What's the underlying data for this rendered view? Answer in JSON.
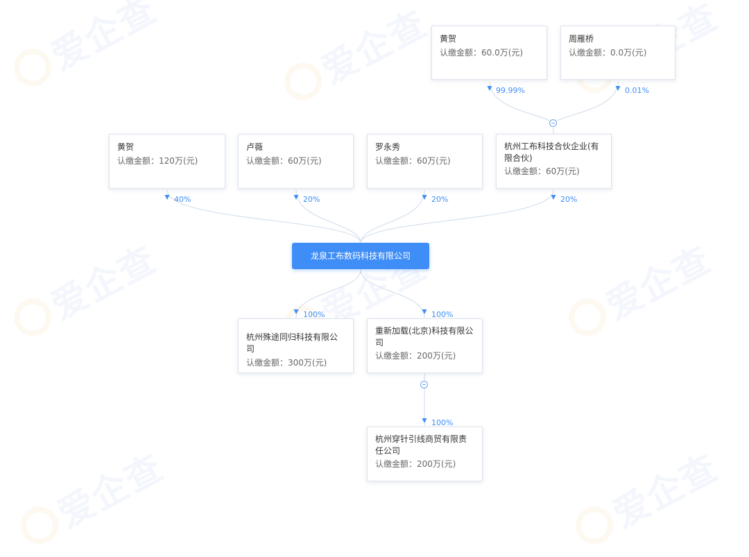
{
  "watermark": {
    "text": "爱企查"
  },
  "root": {
    "name": "龙泉工布数码科技有限公司"
  },
  "shareholders": [
    {
      "id": "s1",
      "name": "黄贺",
      "amount": "认缴金额：120万(元)",
      "percent": "40%"
    },
    {
      "id": "s2",
      "name": "卢薇",
      "amount": "认缴金额：60万(元)",
      "percent": "20%"
    },
    {
      "id": "s3",
      "name": "罗永秀",
      "amount": "认缴金额：60万(元)",
      "percent": "20%"
    },
    {
      "id": "s4",
      "name": "杭州工布科技合伙企业(有限合伙)",
      "amount": "认缴金额：60万(元)",
      "percent": "20%"
    }
  ],
  "upper_shareholders": [
    {
      "id": "u1",
      "name": "黄贺",
      "amount": "认缴金额：60.0万(元)",
      "percent": "99.99%"
    },
    {
      "id": "u2",
      "name": "周雁桥",
      "amount": "认缴金额：0.0万(元)",
      "percent": "0.01%"
    }
  ],
  "investments": [
    {
      "id": "i1",
      "name": "杭州殊途同归科技有限公司",
      "amount": "认缴金额：300万(元)",
      "percent": "100%"
    },
    {
      "id": "i2",
      "name": "重新加载(北京)科技有限公司",
      "amount": "认缴金额：200万(元)",
      "percent": "100%"
    }
  ],
  "sub_investments": [
    {
      "id": "i3",
      "name": "杭州穿针引线商贸有限责任公司",
      "amount": "认缴金额：200万(元)",
      "percent": "100%"
    }
  ],
  "colors": {
    "accent": "#3f8df6",
    "edge": "#d5e0ee",
    "arrow": "#3f8df6"
  }
}
